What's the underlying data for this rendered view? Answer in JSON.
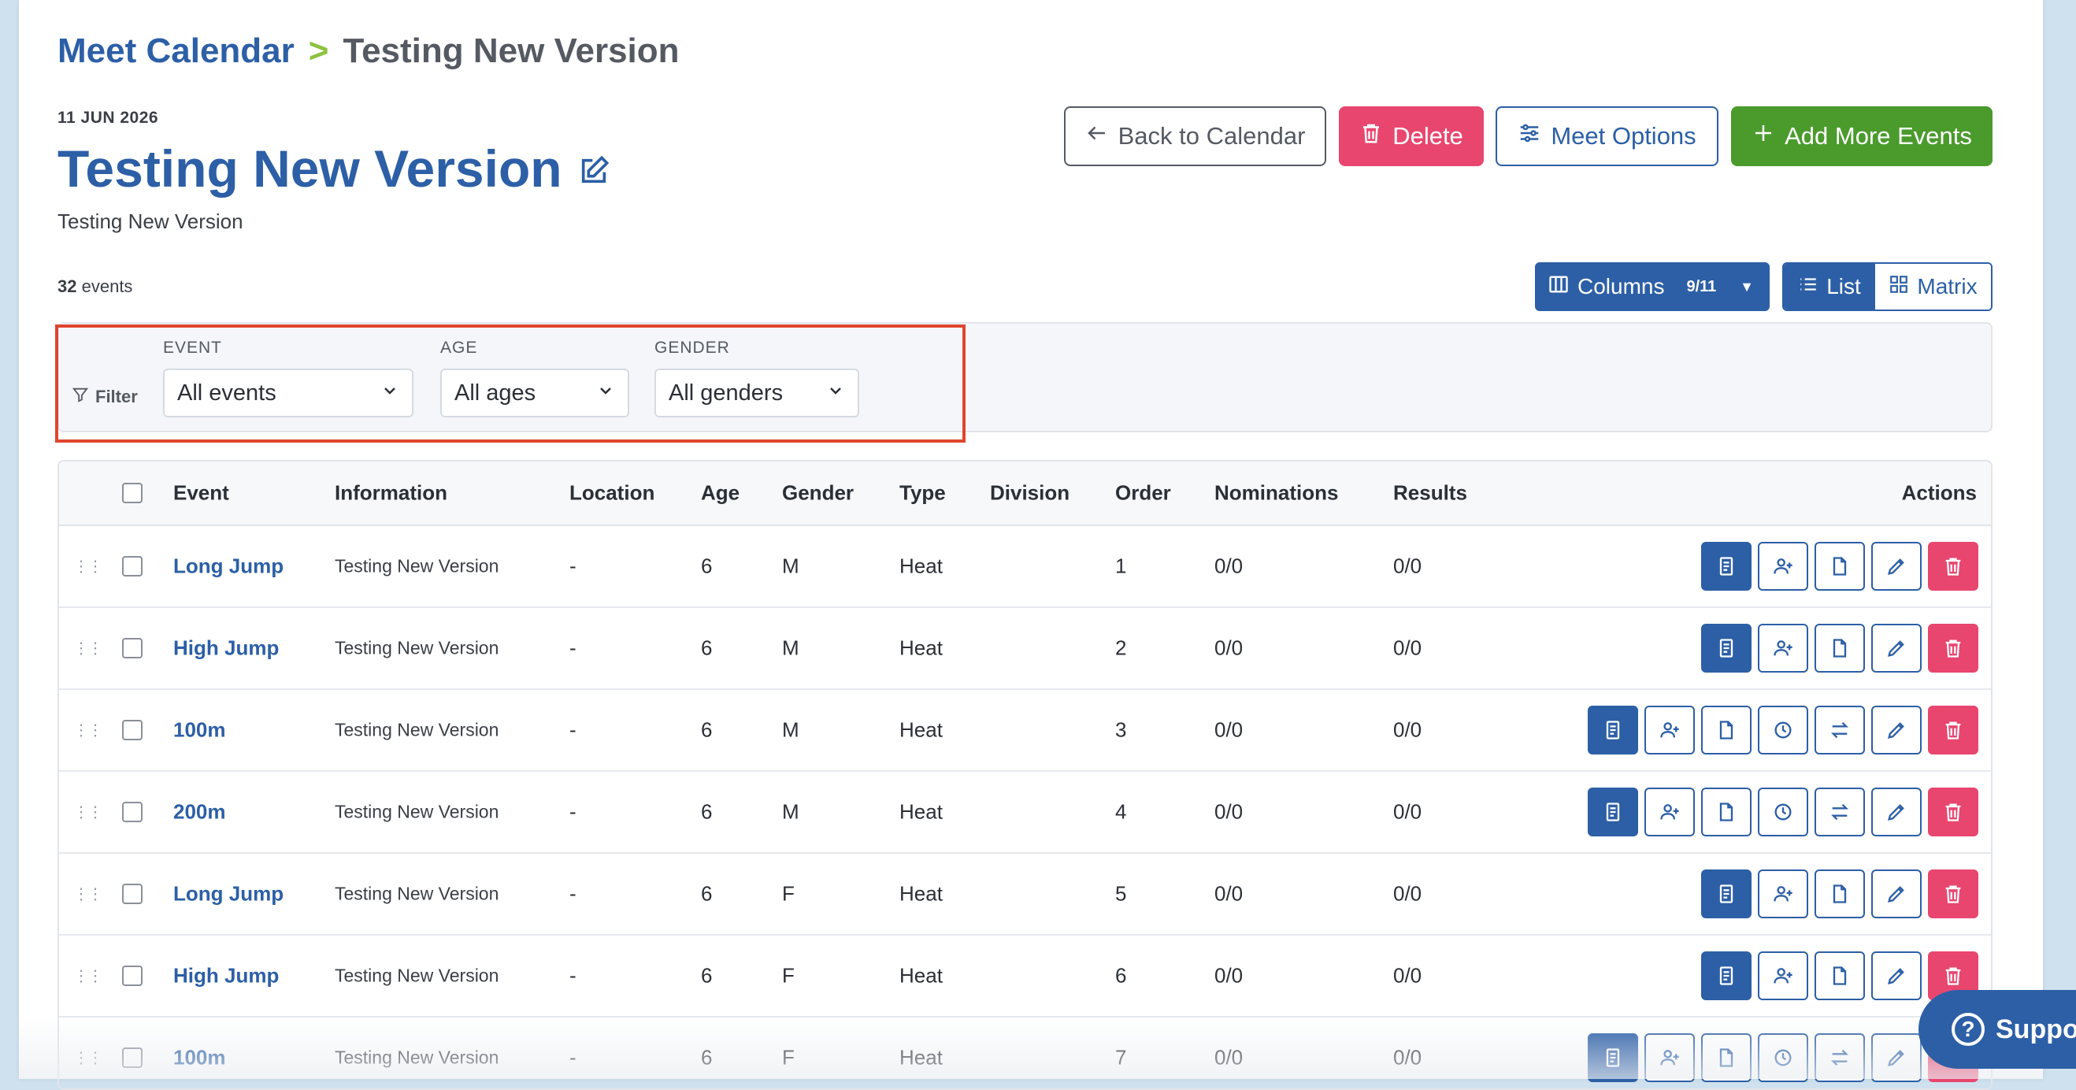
{
  "breadcrumb": {
    "root": "Meet Calendar",
    "separator": ">",
    "current": "Testing New Version"
  },
  "meet": {
    "date": "11 JUN 2026",
    "title": "Testing New Version",
    "description": "Testing New Version",
    "event_count": "32",
    "event_count_suffix": "events"
  },
  "buttons": {
    "back": "Back to Calendar",
    "delete": "Delete",
    "options": "Meet Options",
    "add": "Add More Events"
  },
  "view": {
    "columns_label": "Columns",
    "columns_badge": "9/11",
    "list": "List",
    "matrix": "Matrix"
  },
  "filters": {
    "label": "Filter",
    "event": {
      "label": "EVENT",
      "value": "All events"
    },
    "age": {
      "label": "AGE",
      "value": "All ages"
    },
    "gender": {
      "label": "GENDER",
      "value": "All genders"
    }
  },
  "table": {
    "headers": {
      "event": "Event",
      "information": "Information",
      "location": "Location",
      "age": "Age",
      "gender": "Gender",
      "type": "Type",
      "division": "Division",
      "order": "Order",
      "nominations": "Nominations",
      "results": "Results",
      "actions": "Actions"
    },
    "rows": [
      {
        "event": "Long Jump",
        "information": "Testing New Version",
        "location": "-",
        "age": "6",
        "gender": "M",
        "type": "Heat",
        "order": "1",
        "nominations": "0/0",
        "results": "0/0"
      },
      {
        "event": "High Jump",
        "information": "Testing New Version",
        "location": "-",
        "age": "6",
        "gender": "M",
        "type": "Heat",
        "order": "2",
        "nominations": "0/0",
        "results": "0/0"
      },
      {
        "event": "100m",
        "information": "Testing New Version",
        "location": "-",
        "age": "6",
        "gender": "M",
        "type": "Heat",
        "order": "3",
        "nominations": "0/0",
        "results": "0/0"
      },
      {
        "event": "200m",
        "information": "Testing New Version",
        "location": "-",
        "age": "6",
        "gender": "M",
        "type": "Heat",
        "order": "4",
        "nominations": "0/0",
        "results": "0/0"
      },
      {
        "event": "Long Jump",
        "information": "Testing New Version",
        "location": "-",
        "age": "6",
        "gender": "F",
        "type": "Heat",
        "order": "5",
        "nominations": "0/0",
        "results": "0/0"
      },
      {
        "event": "High Jump",
        "information": "Testing New Version",
        "location": "-",
        "age": "6",
        "gender": "F",
        "type": "Heat",
        "order": "6",
        "nominations": "0/0",
        "results": "0/0"
      },
      {
        "event": "100m",
        "information": "Testing New Version",
        "location": "-",
        "age": "6",
        "gender": "F",
        "type": "Heat",
        "order": "7",
        "nominations": "0/0",
        "results": "0/0"
      }
    ]
  },
  "support": {
    "label": "Suppo"
  },
  "icons": [
    "edit-icon",
    "arrow-left-icon",
    "trash-icon",
    "sliders-icon",
    "plus-icon",
    "columns-icon",
    "list-icon",
    "grid-icon",
    "filter-icon",
    "chevron-down-icon",
    "drag-handle-icon",
    "results-icon",
    "add-user-icon",
    "document-icon",
    "clock-icon",
    "swap-icon",
    "pencil-icon",
    "help-icon"
  ],
  "colors": {
    "primary": "#2c5fa6",
    "danger": "#e8466f",
    "success": "#4a9b2c",
    "accent": "#8cc23f",
    "highlight": "#e0452f"
  }
}
